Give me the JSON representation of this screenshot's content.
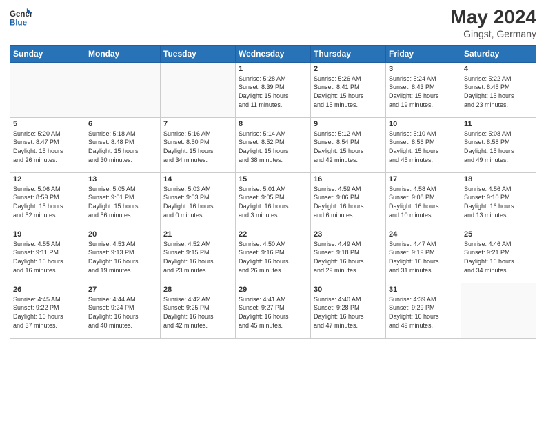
{
  "header": {
    "logo_line1": "General",
    "logo_line2": "Blue",
    "month_year": "May 2024",
    "location": "Gingst, Germany"
  },
  "weekdays": [
    "Sunday",
    "Monday",
    "Tuesday",
    "Wednesday",
    "Thursday",
    "Friday",
    "Saturday"
  ],
  "weeks": [
    [
      {
        "day": "",
        "info": ""
      },
      {
        "day": "",
        "info": ""
      },
      {
        "day": "",
        "info": ""
      },
      {
        "day": "1",
        "info": "Sunrise: 5:28 AM\nSunset: 8:39 PM\nDaylight: 15 hours\nand 11 minutes."
      },
      {
        "day": "2",
        "info": "Sunrise: 5:26 AM\nSunset: 8:41 PM\nDaylight: 15 hours\nand 15 minutes."
      },
      {
        "day": "3",
        "info": "Sunrise: 5:24 AM\nSunset: 8:43 PM\nDaylight: 15 hours\nand 19 minutes."
      },
      {
        "day": "4",
        "info": "Sunrise: 5:22 AM\nSunset: 8:45 PM\nDaylight: 15 hours\nand 23 minutes."
      }
    ],
    [
      {
        "day": "5",
        "info": "Sunrise: 5:20 AM\nSunset: 8:47 PM\nDaylight: 15 hours\nand 26 minutes."
      },
      {
        "day": "6",
        "info": "Sunrise: 5:18 AM\nSunset: 8:48 PM\nDaylight: 15 hours\nand 30 minutes."
      },
      {
        "day": "7",
        "info": "Sunrise: 5:16 AM\nSunset: 8:50 PM\nDaylight: 15 hours\nand 34 minutes."
      },
      {
        "day": "8",
        "info": "Sunrise: 5:14 AM\nSunset: 8:52 PM\nDaylight: 15 hours\nand 38 minutes."
      },
      {
        "day": "9",
        "info": "Sunrise: 5:12 AM\nSunset: 8:54 PM\nDaylight: 15 hours\nand 42 minutes."
      },
      {
        "day": "10",
        "info": "Sunrise: 5:10 AM\nSunset: 8:56 PM\nDaylight: 15 hours\nand 45 minutes."
      },
      {
        "day": "11",
        "info": "Sunrise: 5:08 AM\nSunset: 8:58 PM\nDaylight: 15 hours\nand 49 minutes."
      }
    ],
    [
      {
        "day": "12",
        "info": "Sunrise: 5:06 AM\nSunset: 8:59 PM\nDaylight: 15 hours\nand 52 minutes."
      },
      {
        "day": "13",
        "info": "Sunrise: 5:05 AM\nSunset: 9:01 PM\nDaylight: 15 hours\nand 56 minutes."
      },
      {
        "day": "14",
        "info": "Sunrise: 5:03 AM\nSunset: 9:03 PM\nDaylight: 16 hours\nand 0 minutes."
      },
      {
        "day": "15",
        "info": "Sunrise: 5:01 AM\nSunset: 9:05 PM\nDaylight: 16 hours\nand 3 minutes."
      },
      {
        "day": "16",
        "info": "Sunrise: 4:59 AM\nSunset: 9:06 PM\nDaylight: 16 hours\nand 6 minutes."
      },
      {
        "day": "17",
        "info": "Sunrise: 4:58 AM\nSunset: 9:08 PM\nDaylight: 16 hours\nand 10 minutes."
      },
      {
        "day": "18",
        "info": "Sunrise: 4:56 AM\nSunset: 9:10 PM\nDaylight: 16 hours\nand 13 minutes."
      }
    ],
    [
      {
        "day": "19",
        "info": "Sunrise: 4:55 AM\nSunset: 9:11 PM\nDaylight: 16 hours\nand 16 minutes."
      },
      {
        "day": "20",
        "info": "Sunrise: 4:53 AM\nSunset: 9:13 PM\nDaylight: 16 hours\nand 19 minutes."
      },
      {
        "day": "21",
        "info": "Sunrise: 4:52 AM\nSunset: 9:15 PM\nDaylight: 16 hours\nand 23 minutes."
      },
      {
        "day": "22",
        "info": "Sunrise: 4:50 AM\nSunset: 9:16 PM\nDaylight: 16 hours\nand 26 minutes."
      },
      {
        "day": "23",
        "info": "Sunrise: 4:49 AM\nSunset: 9:18 PM\nDaylight: 16 hours\nand 29 minutes."
      },
      {
        "day": "24",
        "info": "Sunrise: 4:47 AM\nSunset: 9:19 PM\nDaylight: 16 hours\nand 31 minutes."
      },
      {
        "day": "25",
        "info": "Sunrise: 4:46 AM\nSunset: 9:21 PM\nDaylight: 16 hours\nand 34 minutes."
      }
    ],
    [
      {
        "day": "26",
        "info": "Sunrise: 4:45 AM\nSunset: 9:22 PM\nDaylight: 16 hours\nand 37 minutes."
      },
      {
        "day": "27",
        "info": "Sunrise: 4:44 AM\nSunset: 9:24 PM\nDaylight: 16 hours\nand 40 minutes."
      },
      {
        "day": "28",
        "info": "Sunrise: 4:42 AM\nSunset: 9:25 PM\nDaylight: 16 hours\nand 42 minutes."
      },
      {
        "day": "29",
        "info": "Sunrise: 4:41 AM\nSunset: 9:27 PM\nDaylight: 16 hours\nand 45 minutes."
      },
      {
        "day": "30",
        "info": "Sunrise: 4:40 AM\nSunset: 9:28 PM\nDaylight: 16 hours\nand 47 minutes."
      },
      {
        "day": "31",
        "info": "Sunrise: 4:39 AM\nSunset: 9:29 PM\nDaylight: 16 hours\nand 49 minutes."
      },
      {
        "day": "",
        "info": ""
      }
    ]
  ]
}
